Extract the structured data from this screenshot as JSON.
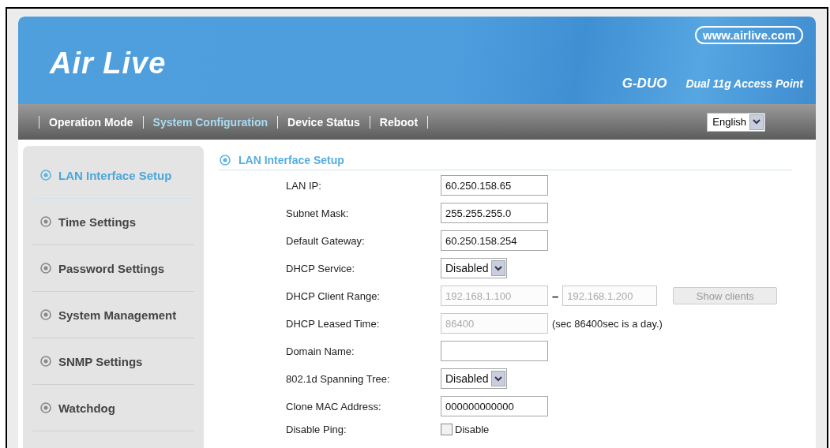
{
  "header": {
    "logo": "Air Live",
    "website": "www.airlive.com",
    "model": "G-DUO",
    "product": "Dual 11g Access Point"
  },
  "nav": {
    "items": [
      {
        "label": "Operation Mode",
        "selected": false
      },
      {
        "label": "System Configuration",
        "selected": true
      },
      {
        "label": "Device Status",
        "selected": false
      },
      {
        "label": "Reboot",
        "selected": false
      }
    ],
    "language": "English"
  },
  "sidebar": {
    "items": [
      {
        "label": "LAN Interface Setup",
        "selected": true
      },
      {
        "label": "Time Settings",
        "selected": false
      },
      {
        "label": "Password Settings",
        "selected": false
      },
      {
        "label": "System Management",
        "selected": false
      },
      {
        "label": "SNMP Settings",
        "selected": false
      },
      {
        "label": "Watchdog",
        "selected": false
      }
    ]
  },
  "section": {
    "title": "LAN Interface Setup"
  },
  "fields": [
    {
      "label": "LAN IP:",
      "kind": "text",
      "value": "60.250.158.65",
      "disabled": false
    },
    {
      "label": "Subnet Mask:",
      "kind": "text",
      "value": "255.255.255.0",
      "disabled": false
    },
    {
      "label": "Default Gateway:",
      "kind": "text",
      "value": "60.250.158.254",
      "disabled": false
    },
    {
      "label": "DHCP Service:",
      "kind": "select",
      "value": "Disabled"
    },
    {
      "label": "DHCP Client Range:",
      "kind": "range",
      "from": "192.168.1.100",
      "separator": "–",
      "to": "192.168.1.200",
      "button": "Show clients",
      "disabled": true
    },
    {
      "label": "DHCP Leased Time:",
      "kind": "text",
      "value": "86400",
      "disabled": true,
      "note": "(sec 86400sec is a day.)"
    },
    {
      "label": "Domain Name:",
      "kind": "text",
      "disabled": false
    },
    {
      "label": "802.1d Spanning Tree:",
      "kind": "select",
      "value": "Disabled"
    },
    {
      "label": "Clone MAC Address:",
      "kind": "text",
      "value": "000000000000",
      "disabled": false
    },
    {
      "label": "Disable Ping:",
      "kind": "checkbox",
      "checked": false,
      "text": "Disable"
    }
  ]
}
